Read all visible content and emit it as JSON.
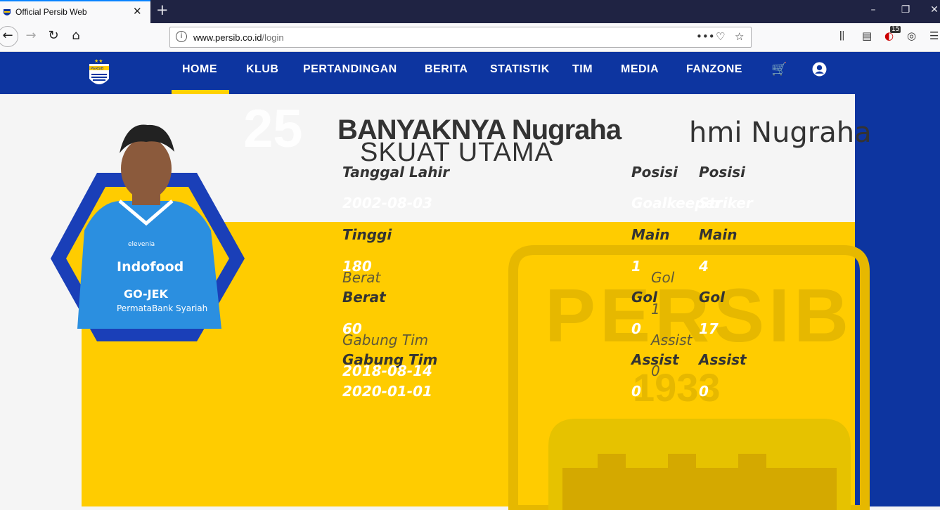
{
  "browser": {
    "tab_title": "Official Persib Web",
    "url_domain": "www.persib.co.id",
    "url_path": "/login",
    "badge_count": "15"
  },
  "site": {
    "menu": [
      "HOME",
      "KLUB",
      "PERTANDINGAN",
      "BERITA",
      "STATISTIK",
      "TIM",
      "MEDIA",
      "FANZONE"
    ],
    "active_menu": "HOME",
    "logo_text": "PERSIB",
    "watermark_text": "PERSIB",
    "watermark_year": "1933"
  },
  "player": {
    "name_part": "hmi Nugraha",
    "section_title": "SKUAT UTAMA",
    "overlap_name": "BANYAKNYA Nugraha",
    "labels": {
      "tanggal_lahir": "Tanggal Lahir",
      "posisi": "Posisi",
      "tinggi": "Tinggi",
      "main": "Main",
      "berat": "Berat",
      "gol": "Gol",
      "gabung_tim": "Gabung Tim",
      "assist": "Assist"
    },
    "values": {
      "tanggal_lahir": "2002-08-03",
      "posisi_1": "Goalkeeper",
      "posisi_2": "Striker",
      "tinggi": "180",
      "main_1": "1",
      "main_2": "4",
      "berat": "60",
      "gol_1": "0",
      "gol_2": "17",
      "gol_3": "1",
      "gabung_tim_1": "2018-08-14",
      "gabung_tim_2": "2020-01-01",
      "assist_1": "0",
      "assist_2": "0"
    },
    "shirt_sponsors": [
      "elevenia",
      "Indofood",
      "GO-JEK",
      "PermataBank Syariah"
    ]
  },
  "colors": {
    "brand_blue": "#0d35a0",
    "brand_yellow": "#ffcc00",
    "active_bar": "#ffd200"
  }
}
